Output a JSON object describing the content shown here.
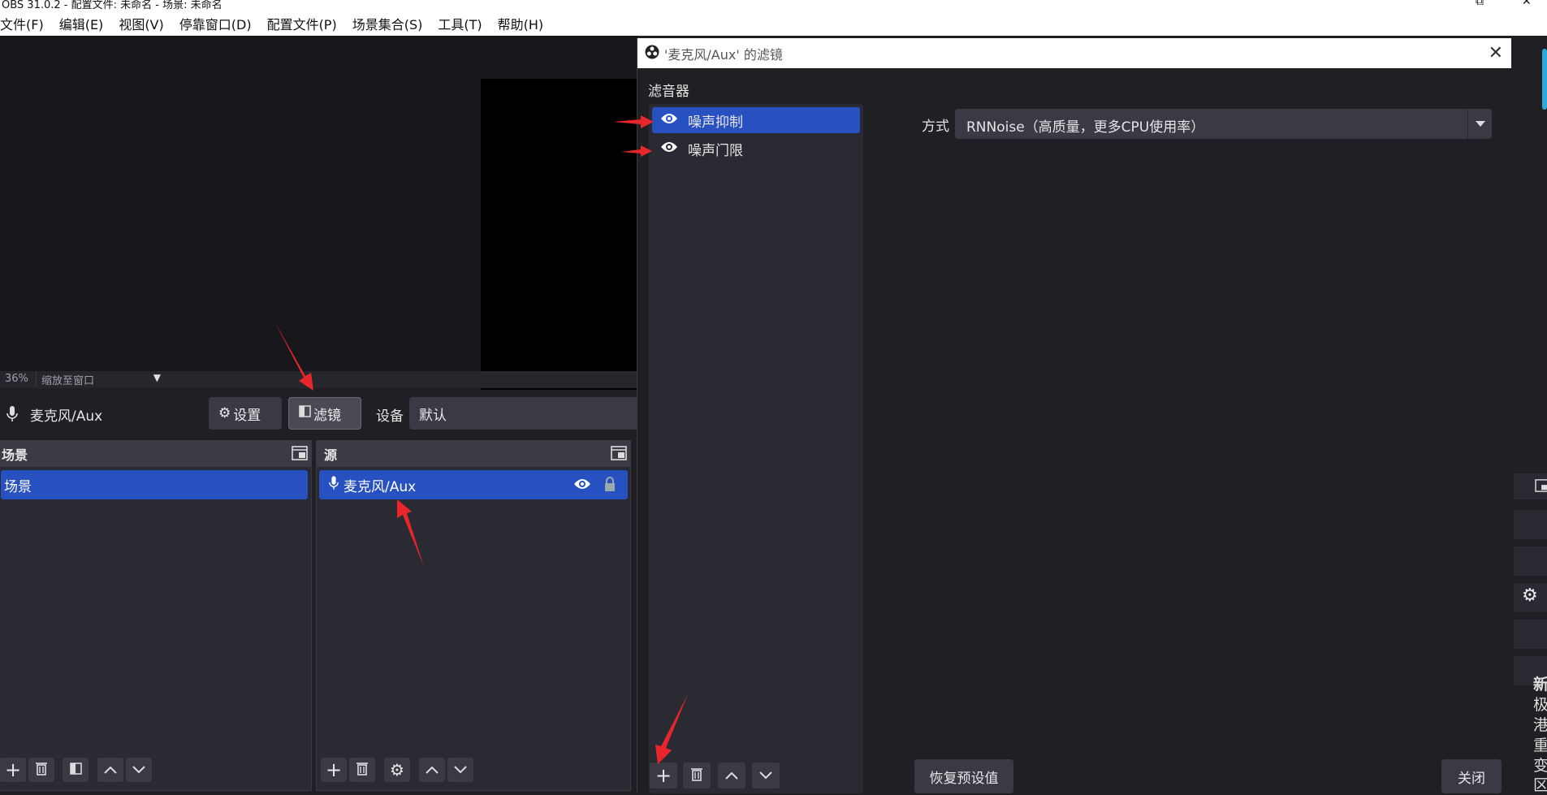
{
  "window": {
    "title": "OBS 31.0.2 - 配置文件: 未命名 - 场景: 未命名"
  },
  "menu": {
    "items": [
      "文件(F)",
      "编辑(E)",
      "视图(V)",
      "停靠窗口(D)",
      "配置文件(P)",
      "场景集合(S)",
      "工具(T)",
      "帮助(H)"
    ]
  },
  "preview": {
    "zoom_percent": "36%",
    "zoom_mode": "缩放至窗口"
  },
  "source_toolbar": {
    "source_name": "麦克风/Aux",
    "settings_label": "设置",
    "filters_label": "滤镜",
    "device_label": "设备",
    "device_value": "默认"
  },
  "scenes": {
    "header": "场景",
    "items": [
      "场景"
    ]
  },
  "sources": {
    "header": "源",
    "items": [
      "麦克风/Aux"
    ]
  },
  "filter_dialog": {
    "title": "'麦克风/Aux' 的滤镜",
    "section_label": "滤音器",
    "filters": [
      "噪声抑制",
      "噪声门限"
    ],
    "method_label": "方式",
    "method_value": "RNNoise（高质量，更多CPU使用率）",
    "reset_label": "恢复预设值",
    "close_label": "关闭"
  },
  "right_panel": {
    "text_chars": [
      "新",
      "极",
      "港",
      "重",
      "变",
      "区"
    ]
  },
  "colors": {
    "accent": "#2750c0",
    "arrow": "#e8262b",
    "scroll": "#2ea9d8"
  }
}
